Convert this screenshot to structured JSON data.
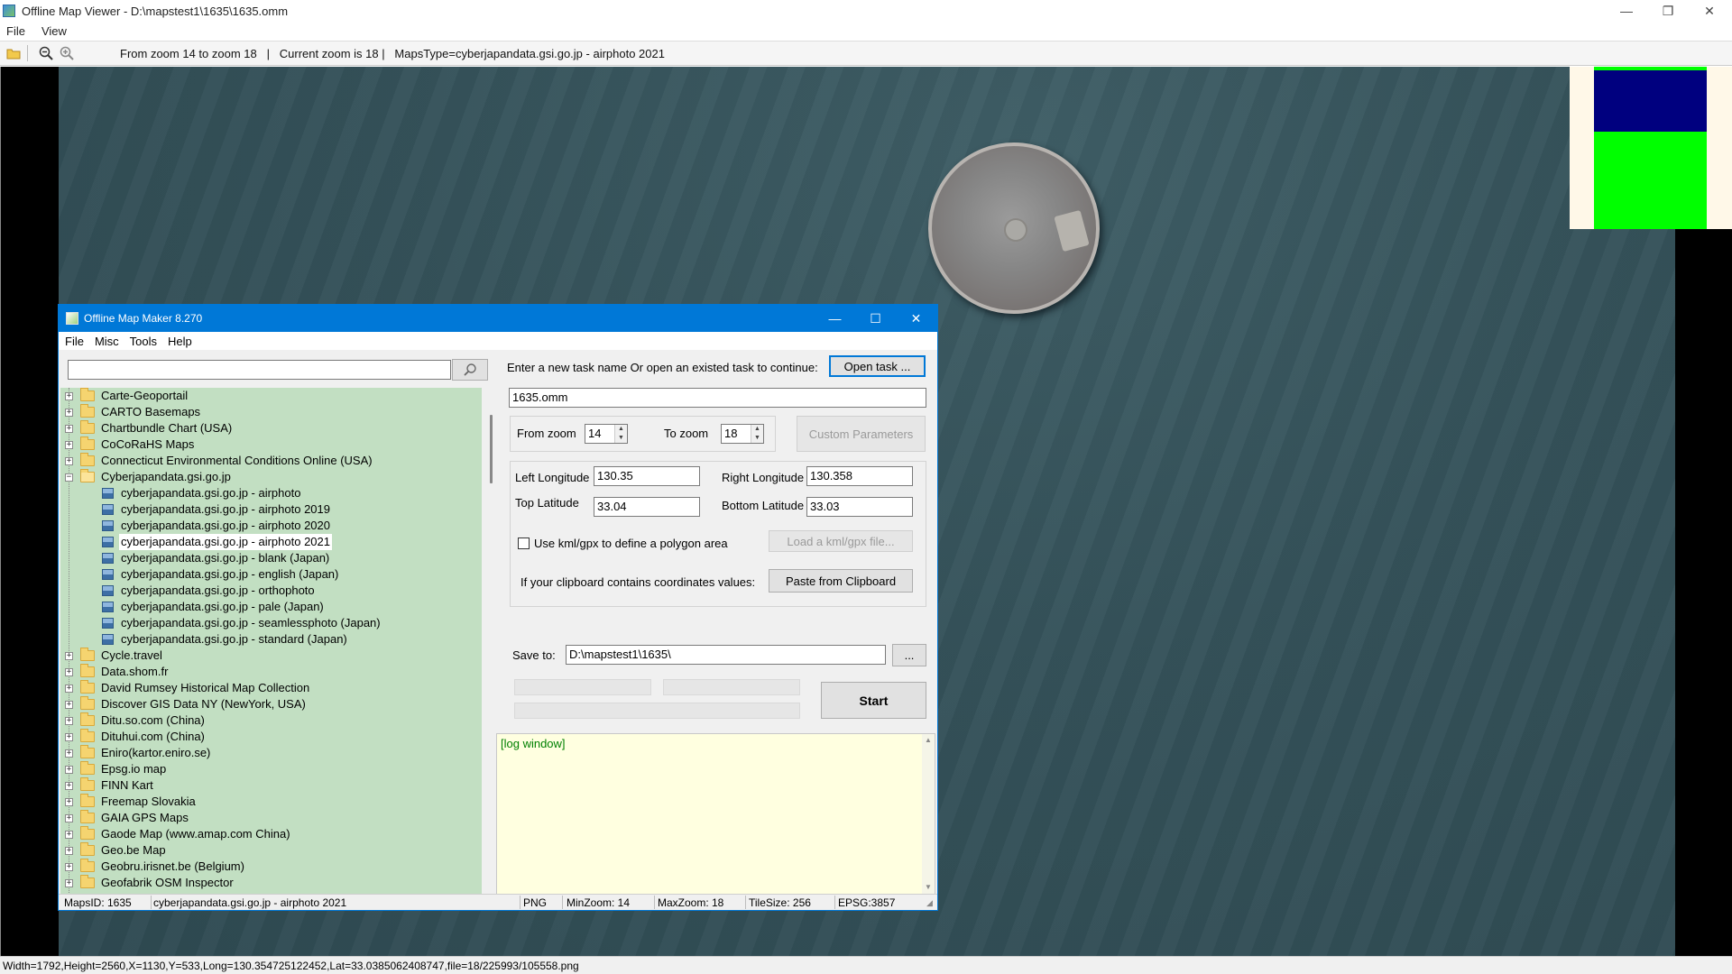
{
  "viewer": {
    "title": "Offline Map Viewer - D:\\mapstest1\\1635\\1635.omm",
    "menu": [
      "File",
      "View"
    ],
    "toolbar_info": "From zoom 14 to zoom 18   |   Current zoom is 18 |   MapsType=cyberjapandata.gsi.go.jp - airphoto 2021",
    "status": "Width=1792,Height=2560,X=1130,Y=533,Long=130.354725122452,Lat=33.0385062408747,file=18/225993/105558.png"
  },
  "colors": {
    "dialog_accent": "#0078d7",
    "tree_background": "#c2dfc2",
    "log_background": "#ffffe0",
    "minimap_blue": "#00007f",
    "minimap_green": "#00ff00"
  },
  "dialog": {
    "title": "Offline Map Maker 8.270",
    "menu": [
      "File",
      "Misc",
      "Tools",
      "Help"
    ],
    "search_value": "",
    "tree": [
      {
        "label": "Carte-Geoportail",
        "type": "folder",
        "expander": "+"
      },
      {
        "label": "CARTO Basemaps",
        "type": "folder",
        "expander": "+"
      },
      {
        "label": "Chartbundle Chart (USA)",
        "type": "folder",
        "expander": "+"
      },
      {
        "label": "CoCoRaHS Maps",
        "type": "folder",
        "expander": "+"
      },
      {
        "label": "Connecticut Environmental Conditions Online (USA)",
        "type": "folder",
        "expander": "+"
      },
      {
        "label": "Cyberjapandata.gsi.go.jp",
        "type": "folder-open",
        "expander": "-"
      },
      {
        "label": "cyberjapandata.gsi.go.jp - airphoto",
        "type": "map"
      },
      {
        "label": "cyberjapandata.gsi.go.jp - airphoto 2019",
        "type": "map"
      },
      {
        "label": "cyberjapandata.gsi.go.jp - airphoto 2020",
        "type": "map"
      },
      {
        "label": "cyberjapandata.gsi.go.jp - airphoto 2021",
        "type": "map",
        "selected": true
      },
      {
        "label": "cyberjapandata.gsi.go.jp - blank (Japan)",
        "type": "map"
      },
      {
        "label": "cyberjapandata.gsi.go.jp - english (Japan)",
        "type": "map"
      },
      {
        "label": "cyberjapandata.gsi.go.jp - orthophoto",
        "type": "map"
      },
      {
        "label": "cyberjapandata.gsi.go.jp - pale (Japan)",
        "type": "map"
      },
      {
        "label": "cyberjapandata.gsi.go.jp - seamlessphoto (Japan)",
        "type": "map"
      },
      {
        "label": "cyberjapandata.gsi.go.jp - standard (Japan)",
        "type": "map"
      },
      {
        "label": "Cycle.travel",
        "type": "folder",
        "expander": "+"
      },
      {
        "label": "Data.shom.fr",
        "type": "folder",
        "expander": "+"
      },
      {
        "label": "David Rumsey Historical Map Collection",
        "type": "folder",
        "expander": "+"
      },
      {
        "label": "Discover GIS Data NY (NewYork, USA)",
        "type": "folder",
        "expander": "+"
      },
      {
        "label": "Ditu.so.com (China)",
        "type": "folder",
        "expander": "+"
      },
      {
        "label": "Dituhui.com (China)",
        "type": "folder",
        "expander": "+"
      },
      {
        "label": "Eniro(kartor.eniro.se)",
        "type": "folder",
        "expander": "+"
      },
      {
        "label": "Epsg.io map",
        "type": "folder",
        "expander": "+"
      },
      {
        "label": "FINN Kart",
        "type": "folder",
        "expander": "+"
      },
      {
        "label": "Freemap Slovakia",
        "type": "folder",
        "expander": "+"
      },
      {
        "label": "GAIA GPS Maps",
        "type": "folder",
        "expander": "+"
      },
      {
        "label": "Gaode Map (www.amap.com China)",
        "type": "folder",
        "expander": "+"
      },
      {
        "label": "Geo.be Map",
        "type": "folder",
        "expander": "+"
      },
      {
        "label": "Geobru.irisnet.be (Belgium)",
        "type": "folder",
        "expander": "+"
      },
      {
        "label": "Geofabrik OSM Inspector",
        "type": "folder",
        "expander": "+"
      }
    ],
    "task_prompt": "Enter a new task name Or open an existed task to continue:",
    "open_task_label": "Open task ...",
    "task_name": "1635.omm",
    "from_zoom_label": "From zoom",
    "from_zoom": "14",
    "to_zoom_label": "To zoom",
    "to_zoom": "18",
    "custom_params_label": "Custom Parameters",
    "left_lon_label": "Left Longitude",
    "left_lon": "130.35",
    "right_lon_label": "Right Longitude",
    "right_lon": "130.358",
    "top_lat_label": "Top Latitude",
    "top_lat": "33.04",
    "bottom_lat_label": "Bottom Latitude",
    "bottom_lat": "33.03",
    "kml_label": "Use kml/gpx to define a polygon area",
    "load_kml_label": "Load a kml/gpx file...",
    "clipboard_label": "If your clipboard contains coordinates values:",
    "paste_label": "Paste from Clipboard",
    "save_to_label": "Save to:",
    "save_to": "D:\\mapstest1\\1635\\",
    "browse_label": "...",
    "start_label": "Start",
    "log_text": "[log window]",
    "status": {
      "maps_id": "MapsID: 1635",
      "map_name": "cyberjapandata.gsi.go.jp - airphoto 2021",
      "format": "PNG",
      "min_zoom": "MinZoom: 14",
      "max_zoom": "MaxZoom: 18",
      "tile_size": "TileSize: 256",
      "epsg": "EPSG:3857"
    }
  }
}
